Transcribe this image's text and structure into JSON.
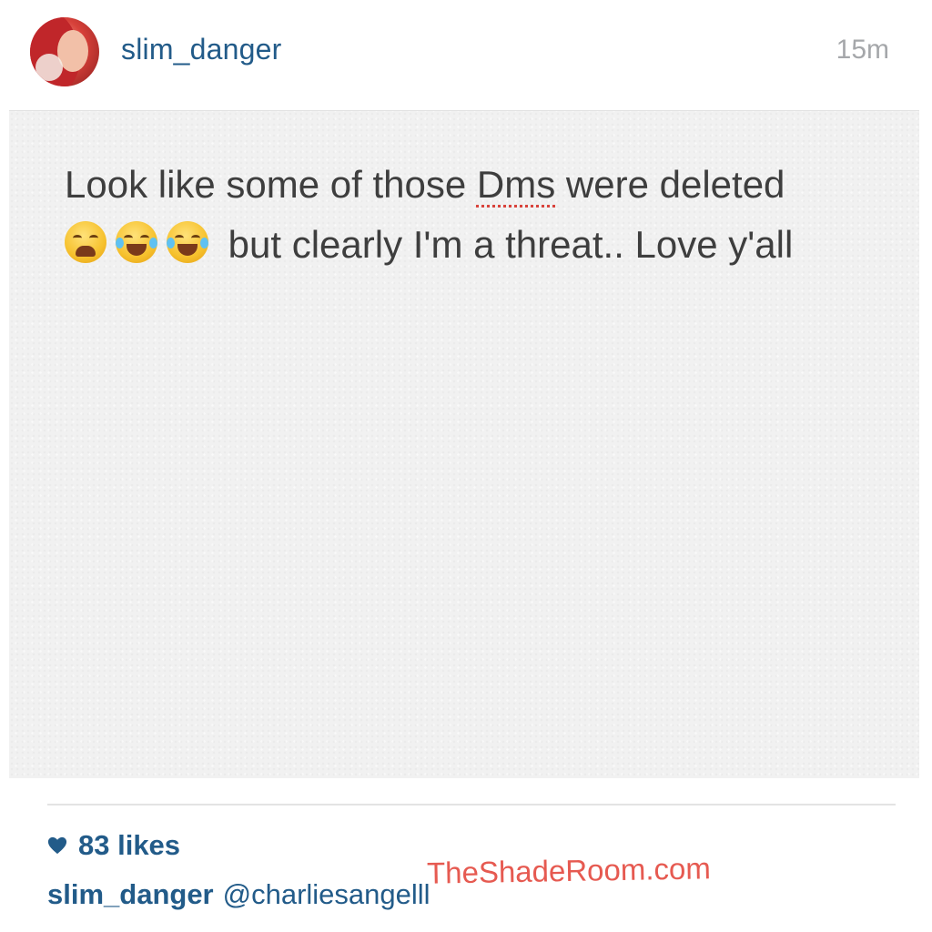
{
  "header": {
    "username": "slim_danger",
    "time": "15m"
  },
  "post": {
    "text_line1_before": "Look like some of those ",
    "text_line1_misspelled": "Dms",
    "text_line1_after": " were deleted",
    "emojis": [
      "weary-face",
      "tears-of-joy",
      "tears-of-joy"
    ],
    "text_line2": "but clearly I'm a threat.. Love y'all"
  },
  "footer": {
    "likes": "83 likes",
    "caption_user": "slim_danger",
    "caption_mention": "@charliesangelll",
    "watermark": "TheShadeRoom.com"
  },
  "colors": {
    "link": "#225b89",
    "timestamp": "#a5a7aa",
    "watermark": "#e4493f"
  }
}
